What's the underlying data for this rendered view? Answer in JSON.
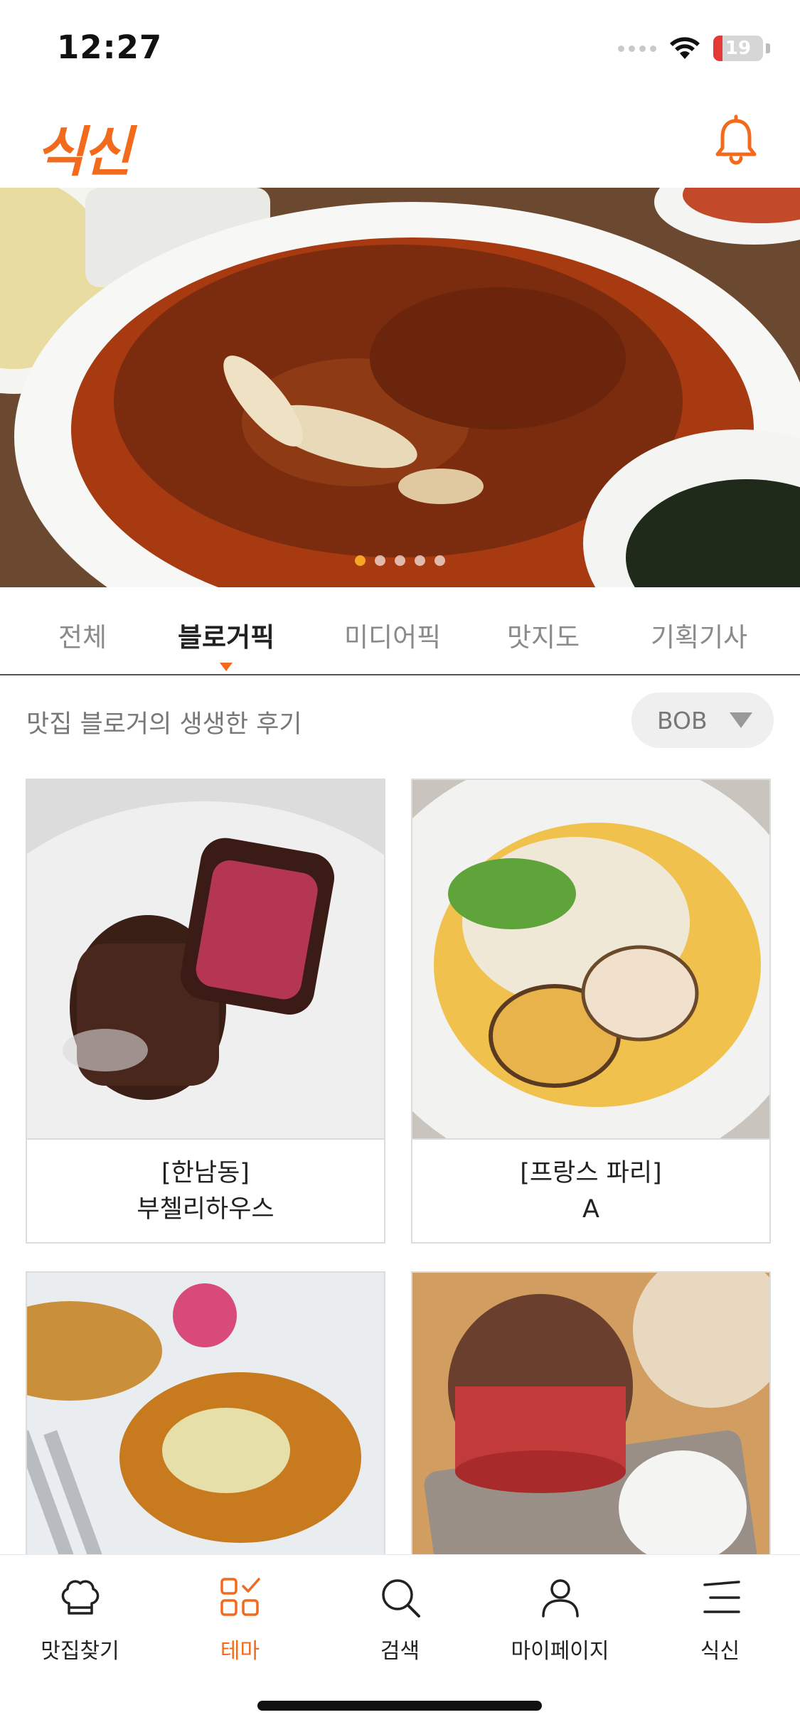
{
  "status_bar": {
    "time": "12:27",
    "battery": "19",
    "battery_level": 0.19
  },
  "header": {
    "logo": "식신",
    "notification_icon": "bell-icon"
  },
  "hero": {
    "slide_count": 5,
    "active_slide": 1
  },
  "tabs": [
    {
      "label": "전체",
      "active": false
    },
    {
      "label": "블로거픽",
      "active": true
    },
    {
      "label": "미디어픽",
      "active": false
    },
    {
      "label": "맛지도",
      "active": false
    },
    {
      "label": "기획기사",
      "active": false
    }
  ],
  "subheader": {
    "text": "맛집 블로거의 생생한 후기",
    "filter_value": "BOB"
  },
  "cards": [
    {
      "line1": "[한남동]",
      "line2": "부첼리하우스"
    },
    {
      "line1": "[프랑스 파리]",
      "line2": "A"
    },
    {
      "line1": "",
      "line2": ""
    },
    {
      "line1": "",
      "line2": ""
    }
  ],
  "bottom_nav": [
    {
      "label": "맛집찾기",
      "icon": "chef-hat-icon",
      "active": false
    },
    {
      "label": "테마",
      "icon": "theme-grid-icon",
      "active": true
    },
    {
      "label": "검색",
      "icon": "search-icon",
      "active": false
    },
    {
      "label": "마이페이지",
      "icon": "user-icon",
      "active": false
    },
    {
      "label": "식신",
      "icon": "menu-icon",
      "active": false
    }
  ],
  "colors": {
    "accent": "#f26a1b",
    "dot_active": "#f6a623",
    "battery_low": "#e53935"
  }
}
